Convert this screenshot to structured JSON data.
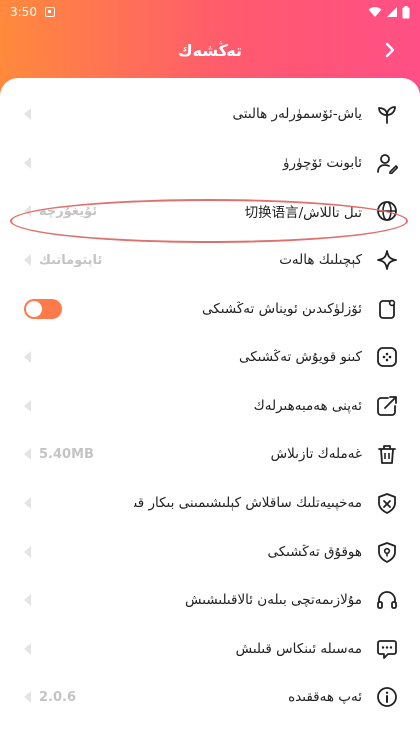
{
  "status": {
    "time": "3:50"
  },
  "header": {
    "title": "تەڭشەك",
    "back_glyph": "›"
  },
  "rows": [
    {
      "label": "ياش-ئۆسمۈرلەر ھالىتى",
      "value": "",
      "icon": "sprout-icon"
    },
    {
      "label": "ئابونت ئۆچۈرۈ",
      "value": "",
      "icon": "user-edit-icon"
    },
    {
      "label": "تىل تاللاش/切换语言",
      "value": "ئۇيغۇرچە",
      "icon": "globe-icon"
    },
    {
      "label": "كېچىلىك ھالەت",
      "value": "ئاپتوماتىك",
      "icon": "sparkle-icon"
    },
    {
      "label": "ئۆزلۈكىدىن ئويناش تەڭشىكى",
      "value": "",
      "icon": "mobile-play-icon",
      "toggle": true
    },
    {
      "label": "كىنو قويۇش تەڭشىكى",
      "value": "",
      "icon": "gamepad-icon"
    },
    {
      "label": "ئەپنى ھەمبەھىرلەك",
      "value": "",
      "icon": "share-icon"
    },
    {
      "label": "غەملەك تازىلاش",
      "value": "5.40MB",
      "icon": "trash-icon"
    },
    {
      "label": "مەخپىيەتلىك ساقلاش كېلىشىمىنى بىكار قىلىش",
      "value": "",
      "icon": "shield-x-icon"
    },
    {
      "label": "ھوقۇق تەڭشىكى",
      "value": "",
      "icon": "shield-key-icon"
    },
    {
      "label": "مۇلازىمەتچى بىلەن ئالاقىلىشىش",
      "value": "",
      "icon": "headset-icon"
    },
    {
      "label": "مەسىلە ئىنكاس قىلىش",
      "value": "",
      "icon": "chat-icon"
    },
    {
      "label": "ئەپ ھەققىدە",
      "value": "2.0.6",
      "icon": "info-icon"
    }
  ],
  "colors": {
    "accent": "#ff5a6e",
    "toggle": "#ff7a4a"
  }
}
